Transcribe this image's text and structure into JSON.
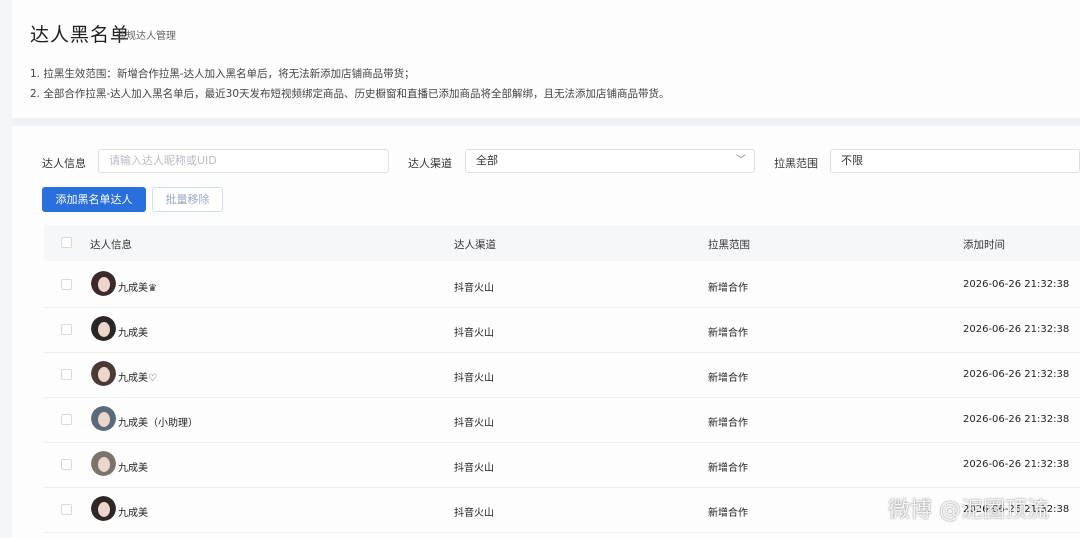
{
  "page": {
    "title": "达人黑名单",
    "subtitle": "违规达人管理",
    "rules": [
      "1. 拉黑生效范围：新增合作拉黑-达人加入黑名单后，将无法新添加店铺商品带货；",
      "2. 全部合作拉黑-达人加入黑名单后，最近30天发布短视频绑定商品、历史橱窗和直播已添加商品将全部解绑，且无法添加店铺商品带货。"
    ]
  },
  "filters": {
    "talent_info_label": "达人信息",
    "talent_info_placeholder": "请输入达人昵称或UID",
    "channel_label": "达人渠道",
    "channel_value": "全部",
    "scope_label": "拉黑范围",
    "scope_value": "不限"
  },
  "actions": {
    "add_label": "添加黑名单达人",
    "batch_remove_label": "批量移除"
  },
  "table": {
    "headers": [
      "达人信息",
      "达人渠道",
      "拉黑范围",
      "添加时间"
    ],
    "rows": [
      {
        "name": "九成美",
        "badge": "♛",
        "channel": "抖音火山",
        "scope": "新增合作",
        "time": "2026-06-26 21:32:38",
        "hair": "#3a2b28"
      },
      {
        "name": "九成美",
        "badge": "",
        "channel": "抖音火山",
        "scope": "新增合作",
        "time": "2026-06-26 21:32:38",
        "hair": "#2a2626"
      },
      {
        "name": "九成美",
        "badge": "♡",
        "channel": "抖音火山",
        "scope": "新增合作",
        "time": "2026-06-26 21:32:38",
        "hair": "#4a3a36"
      },
      {
        "name": "九成美（小助理）",
        "badge": "",
        "channel": "抖音火山",
        "scope": "新增合作",
        "time": "2026-06-26 21:32:38",
        "hair": "#5b6a7a"
      },
      {
        "name": "九成美",
        "badge": "",
        "channel": "抖音火山",
        "scope": "新增合作",
        "time": "2026-06-26 21:32:38",
        "hair": "#7a746c"
      },
      {
        "name": "九成美",
        "badge": "",
        "channel": "抖音火山",
        "scope": "新增合作",
        "time": "2026-06-26 21:32:38",
        "hair": "#2f2725"
      }
    ]
  },
  "watermark": "微博 @泥圈顶流",
  "colors": {
    "primary": "#2a6fde",
    "background": "#f0f2f5"
  }
}
